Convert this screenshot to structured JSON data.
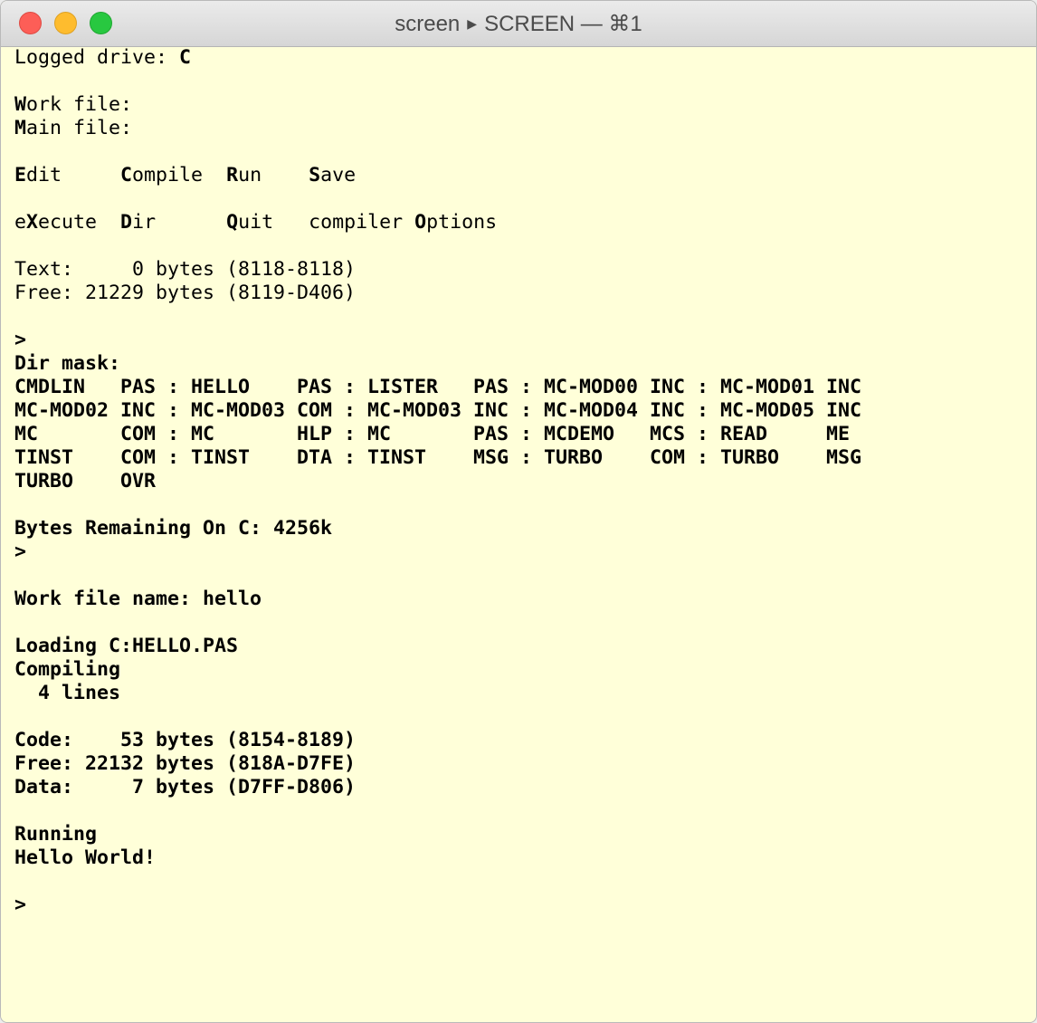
{
  "window": {
    "title_left": "screen",
    "title_right": "SCREEN — ⌘1"
  },
  "terminal": {
    "lines": [
      [
        {
          "t": "Logged drive: "
        },
        {
          "t": "C",
          "b": true
        }
      ],
      [],
      [
        {
          "t": "W",
          "b": true
        },
        {
          "t": "ork file:"
        }
      ],
      [
        {
          "t": "M",
          "b": true
        },
        {
          "t": "ain file:"
        }
      ],
      [],
      [
        {
          "t": "E",
          "b": true
        },
        {
          "t": "dit     "
        },
        {
          "t": "C",
          "b": true
        },
        {
          "t": "ompile  "
        },
        {
          "t": "R",
          "b": true
        },
        {
          "t": "un    "
        },
        {
          "t": "S",
          "b": true
        },
        {
          "t": "ave"
        }
      ],
      [],
      [
        {
          "t": "e"
        },
        {
          "t": "X",
          "b": true
        },
        {
          "t": "ecute  "
        },
        {
          "t": "D",
          "b": true
        },
        {
          "t": "ir      "
        },
        {
          "t": "Q",
          "b": true
        },
        {
          "t": "uit   compiler "
        },
        {
          "t": "O",
          "b": true
        },
        {
          "t": "ptions"
        }
      ],
      [],
      [
        {
          "t": "Text:     0 bytes (8118-8118)"
        }
      ],
      [
        {
          "t": "Free: 21229 bytes (8119-D406)"
        }
      ],
      [],
      [
        {
          "t": ">",
          "b": true
        }
      ],
      [
        {
          "t": "Dir mask:",
          "b": true
        }
      ],
      [
        {
          "t": "CMDLIN   PAS : HELLO    PAS : LISTER   PAS : MC-MOD00 INC : MC-MOD01 INC",
          "b": true
        }
      ],
      [
        {
          "t": "MC-MOD02 INC : MC-MOD03 COM : MC-MOD03 INC : MC-MOD04 INC : MC-MOD05 INC",
          "b": true
        }
      ],
      [
        {
          "t": "MC       COM : MC       HLP : MC       PAS : MCDEMO   MCS : READ     ME",
          "b": true
        }
      ],
      [
        {
          "t": "TINST    COM : TINST    DTA : TINST    MSG : TURBO    COM : TURBO    MSG",
          "b": true
        }
      ],
      [
        {
          "t": "TURBO    OVR",
          "b": true
        }
      ],
      [],
      [
        {
          "t": "Bytes Remaining On C: 4256k",
          "b": true
        }
      ],
      [
        {
          "t": ">",
          "b": true
        }
      ],
      [],
      [
        {
          "t": "Work file name: hello",
          "b": true
        }
      ],
      [],
      [
        {
          "t": "Loading C:HELLO.PAS",
          "b": true
        }
      ],
      [
        {
          "t": "Compiling",
          "b": true
        }
      ],
      [
        {
          "t": "  4 lines",
          "b": true
        }
      ],
      [],
      [
        {
          "t": "Code:    53 bytes (8154-8189)",
          "b": true
        }
      ],
      [
        {
          "t": "Free: 22132 bytes (818A-D7FE)",
          "b": true
        }
      ],
      [
        {
          "t": "Data:     7 bytes (D7FF-D806)",
          "b": true
        }
      ],
      [],
      [
        {
          "t": "Running",
          "b": true
        }
      ],
      [
        {
          "t": "Hello World!",
          "b": true
        }
      ],
      [],
      [
        {
          "t": ">",
          "b": true
        }
      ]
    ]
  }
}
